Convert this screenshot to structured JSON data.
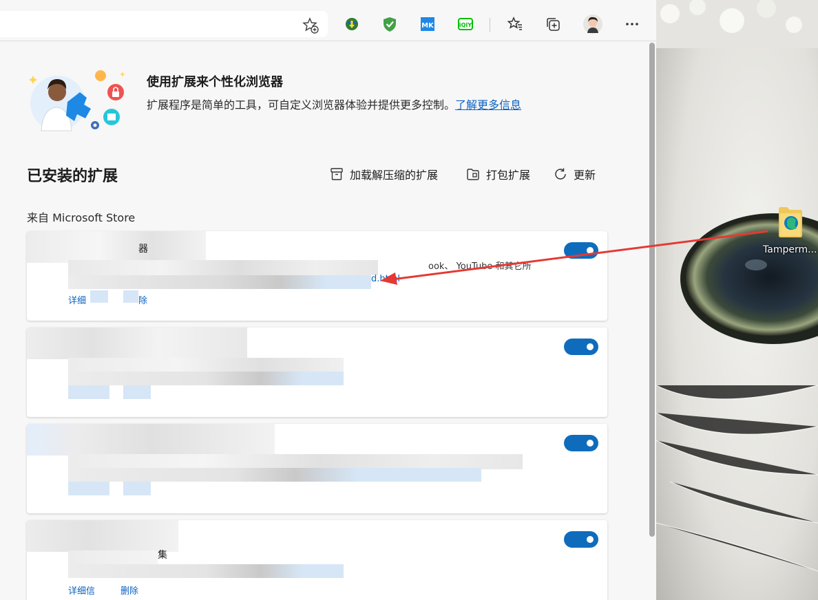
{
  "toolbar": {
    "icons": [
      "favorite-add-icon",
      "download-manager-icon",
      "adguard-shield-icon",
      "mk-extension-icon",
      "iqiyi-extension-icon",
      "favorites-icon",
      "collections-icon",
      "profile-avatar",
      "more-icon"
    ]
  },
  "hero": {
    "title": "使用扩展来个性化浏览器",
    "description": "扩展程序是简单的工具，可自定义浏览器体验并提供更多控制。",
    "link": "了解更多信息"
  },
  "installed": {
    "title": "已安装的扩展",
    "load_unpacked": "加载解压缩的扩展",
    "pack": "打包扩展",
    "update": "更新"
  },
  "store_section": {
    "label": "来自 Microsoft Store"
  },
  "extensions": [
    {
      "name_fragment": "器",
      "desc_fragment": "ook、 YouTube 和其它所",
      "link_fragment": "d.html",
      "details_fragment": "详细",
      "remove_fragment": "除",
      "enabled": true
    },
    {
      "enabled": true
    },
    {
      "enabled": true
    },
    {
      "name_fragment": "集",
      "details_fragment": "详细信",
      "remove_fragment": "删除",
      "enabled": true
    }
  ],
  "desktop": {
    "file_label": "Tamperm..."
  },
  "colors": {
    "accent": "#0f6cbd",
    "link": "#0b62c2",
    "annotation_arrow": "#e53935"
  }
}
